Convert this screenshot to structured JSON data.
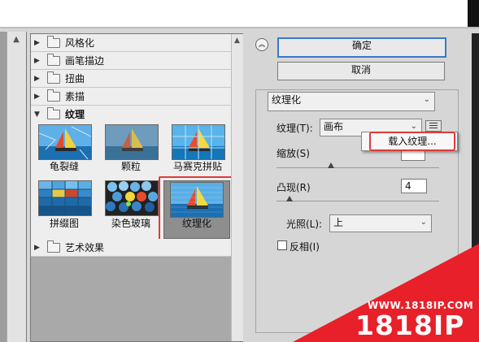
{
  "buttons": {
    "ok": "确定",
    "cancel": "取消"
  },
  "categories": {
    "stylize": "风格化",
    "brush_strokes": "画笔描边",
    "distort": "扭曲",
    "sketch": "素描",
    "texture": "纹理",
    "artistic": "艺术效果"
  },
  "thumbnails": [
    {
      "label": "龟裂缝"
    },
    {
      "label": "颗粒"
    },
    {
      "label": "马赛克拼贴"
    },
    {
      "label": "拼缀图"
    },
    {
      "label": "染色玻璃"
    },
    {
      "label": "纹理化"
    }
  ],
  "controls": {
    "filter_select": "纹理化",
    "texture_label": "纹理(T):",
    "texture_value": "画布",
    "load_texture": "载入纹理...",
    "scale_label": "缩放(S)",
    "relief_label": "凸现(R)",
    "relief_value": "4",
    "light_label": "光照(L):",
    "light_value": "上",
    "invert_label": "反相(I)"
  },
  "watermark": {
    "url": "WWW.1818IP.COM",
    "logo": "1818IP"
  },
  "colors": {
    "highlight": "#e03a3a",
    "ok_border": "#3a79c8",
    "banner": "#e8202a"
  }
}
